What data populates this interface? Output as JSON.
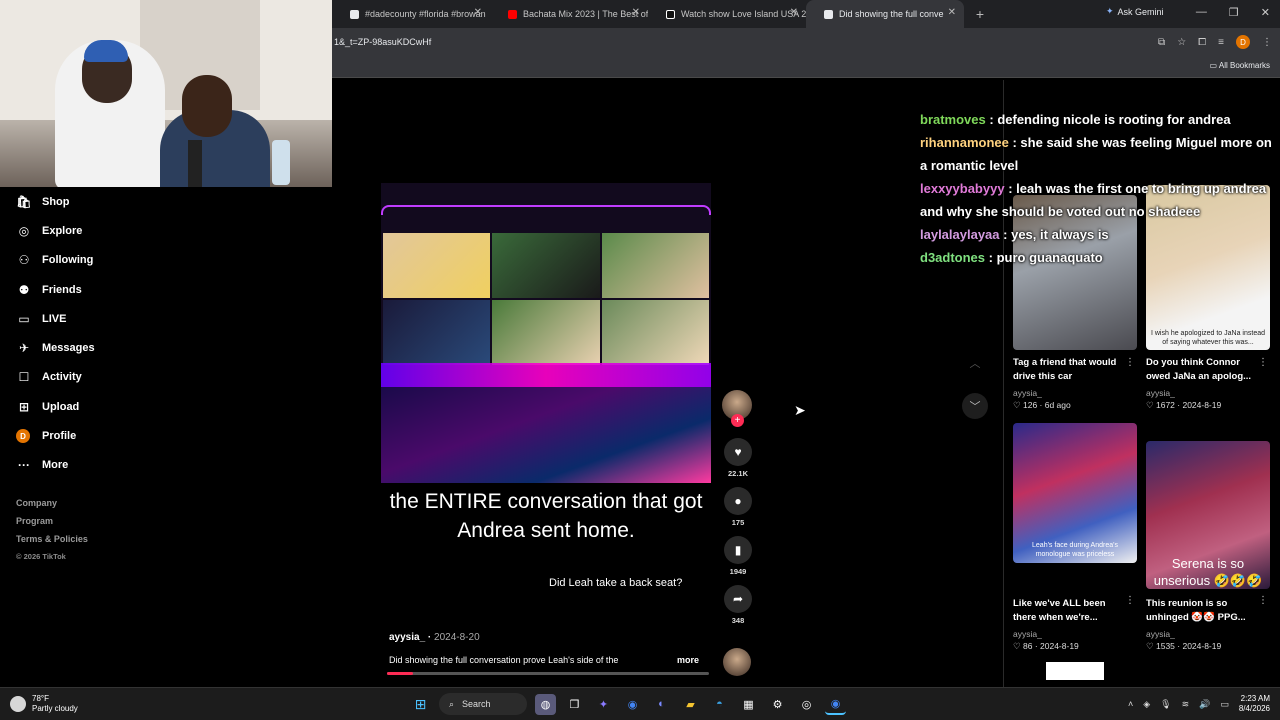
{
  "browser": {
    "tabs": [
      {
        "label": "#dadecounty #florida #browan",
        "icon": "tiktok-icon"
      },
      {
        "label": "Bachata Mix 2023 | The Best of",
        "icon": "youtube-icon"
      },
      {
        "label": "Watch show Love Island USA 2",
        "icon": "peacock-icon"
      },
      {
        "label": "Did showing the full conve",
        "icon": "tiktok-icon",
        "active": true
      }
    ],
    "ask_gemini": "Ask Gemini",
    "url": "1&_t=ZP-98asuKDCwHf",
    "all_bookmarks": "All Bookmarks",
    "profile_initial": "D"
  },
  "sidebar": {
    "items": [
      {
        "label": "Shop",
        "icon": "shop-icon"
      },
      {
        "label": "Explore",
        "icon": "compass-icon"
      },
      {
        "label": "Following",
        "icon": "person-icon"
      },
      {
        "label": "Friends",
        "icon": "friends-icon"
      },
      {
        "label": "LIVE",
        "icon": "live-icon"
      },
      {
        "label": "Messages",
        "icon": "messages-icon"
      },
      {
        "label": "Activity",
        "icon": "activity-icon"
      },
      {
        "label": "Upload",
        "icon": "upload-icon"
      },
      {
        "label": "Profile",
        "icon": "profile-avatar"
      },
      {
        "label": "More",
        "icon": "more-icon"
      }
    ],
    "profile_initial": "D",
    "footer": {
      "company": "Company",
      "program": "Program",
      "terms": "Terms & Policies",
      "copyright": "© 2026 TikTok"
    }
  },
  "video": {
    "caption": "the ENTIRE conversation that got Andrea sent home.",
    "subcaption": "Did Leah take a back seat?",
    "author": "ayysia_",
    "date": "2024-8-20",
    "description": "Did showing the full conversation prove Leah's side of the",
    "more_label": "more",
    "progress": 0.08
  },
  "actions": {
    "likes": "22.1K",
    "comments": "175",
    "saves": "1949",
    "shares": "348"
  },
  "chat": [
    {
      "user": "bratmoves",
      "text": ": defending nicole is rooting for andrea"
    },
    {
      "user": "rihannamonee",
      "text": ": she said she was feeling Miguel more on a romantic level"
    },
    {
      "user": "lexxyybabyyy",
      "text": ": leah was the first one to bring up andrea and why she should be voted out no shadeee"
    },
    {
      "user": "laylalaylayaa",
      "text": ": yes, it always is"
    },
    {
      "user": "d3adtones",
      "text": ": puro guanaquato"
    }
  ],
  "suggested": [
    {
      "title": "Tag a friend that would drive this car",
      "author": "ayysia_",
      "likes": "126",
      "date": "6d ago",
      "thumb_text": ""
    },
    {
      "title": "Do you think Connor owed JaNa an apolog...",
      "author": "ayysia_",
      "likes": "1672",
      "date": "2024-8-19",
      "thumb_text": "I wish he apologized to JaNa instead of saying whatever this was..."
    },
    {
      "title": "Like we've ALL been there when we're...",
      "author": "ayysia_",
      "likes": "86",
      "date": "2024-8-19",
      "thumb_text": "Leah's face during Andrea's monologue was priceless"
    },
    {
      "title": "This reunion is so unhinged 🤡🤡 PPG...",
      "author": "ayysia_",
      "likes": "1535",
      "date": "2024-8-19",
      "thumb_text": ""
    }
  ],
  "serena_caption": "Serena is so unserious 🤣🤣🤣",
  "taskbar": {
    "temp": "78°F",
    "weather": "Partly cloudy",
    "search": "Search",
    "time": "2:23 AM",
    "date": "8/4/2026"
  }
}
